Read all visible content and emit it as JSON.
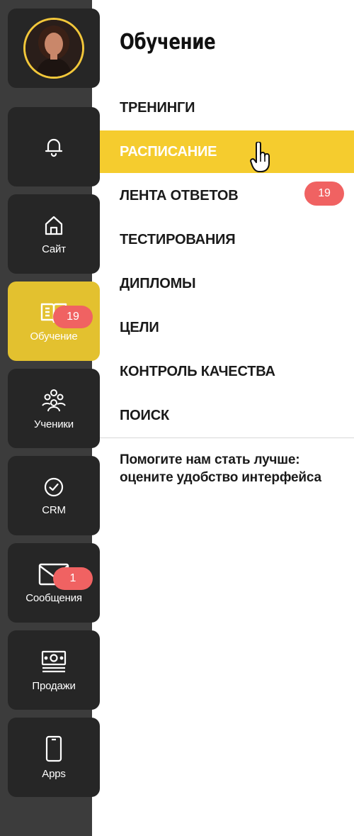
{
  "sidebar": {
    "items": [
      {
        "id": "avatar",
        "label": ""
      },
      {
        "id": "notifications",
        "label": ""
      },
      {
        "id": "site",
        "label": "Сайт"
      },
      {
        "id": "learning",
        "label": "Обучение",
        "badge": "19",
        "active": true
      },
      {
        "id": "students",
        "label": "Ученики"
      },
      {
        "id": "crm",
        "label": "CRM"
      },
      {
        "id": "messages",
        "label": "Сообщения",
        "badge": "1"
      },
      {
        "id": "sales",
        "label": "Продажи"
      },
      {
        "id": "apps",
        "label": "Apps"
      }
    ]
  },
  "menu": {
    "title": "Обучение",
    "items": [
      {
        "label": "ТРЕНИНГИ"
      },
      {
        "label": "РАСПИСАНИЕ",
        "active": true
      },
      {
        "label": "ЛЕНТА ОТВЕТОВ",
        "badge": "19"
      },
      {
        "label": "ТЕСТИРОВАНИЯ"
      },
      {
        "label": "ДИПЛОМЫ"
      },
      {
        "label": "ЦЕЛИ"
      },
      {
        "label": "КОНТРОЛЬ КАЧЕСТВА"
      },
      {
        "label": "ПОИСК"
      }
    ],
    "feedback": "Помогите нам стать лучше: оцените удобство интерфейса"
  },
  "colors": {
    "rail_bg": "#3c3c3c",
    "tile_bg": "#262626",
    "accent": "#f5cc2e",
    "badge": "#f06262"
  }
}
